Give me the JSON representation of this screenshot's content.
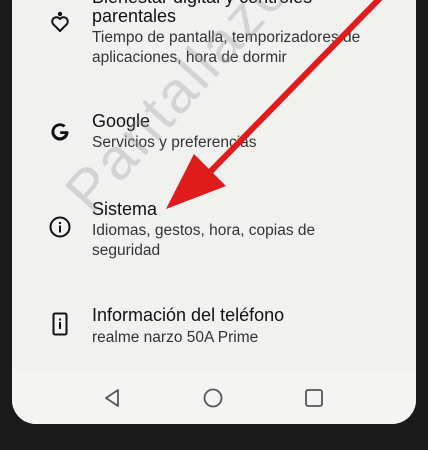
{
  "settings": {
    "items": [
      {
        "icon": "digital-wellbeing-icon",
        "title_partial": "Bienestar digital y controles",
        "title_line2": "parentales",
        "subtitle": "Tiempo de pantalla, temporizadores de aplicaciones, hora de dormir"
      },
      {
        "icon": "google-g-icon",
        "title": "Google",
        "subtitle": "Servicios y preferencias"
      },
      {
        "icon": "info-circle-icon",
        "title": "Sistema",
        "subtitle": "Idiomas, gestos, hora, copias de seguridad"
      },
      {
        "icon": "phone-info-icon",
        "title": "Información del teléfono",
        "subtitle": "realme narzo 50A Prime"
      }
    ]
  },
  "navigation": {
    "back": "back-triangle-icon",
    "home": "home-circle-icon",
    "recents": "recents-square-icon"
  },
  "watermark": "Pantallazo.es",
  "annotation": {
    "arrow_color": "#e01b1b"
  }
}
